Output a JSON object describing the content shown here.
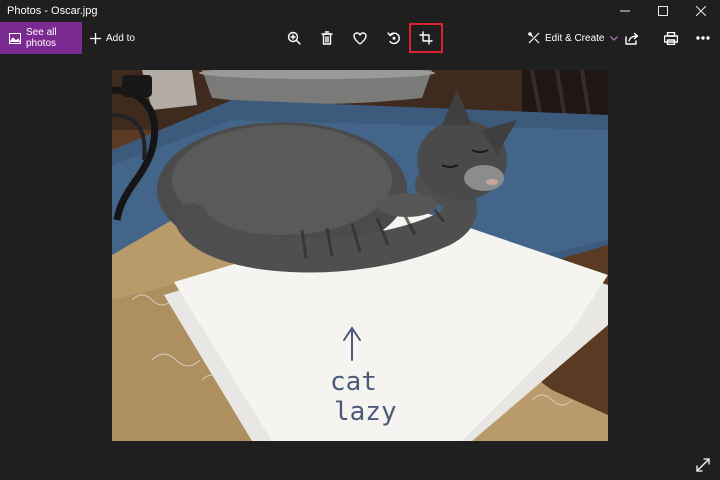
{
  "window": {
    "title": "Photos - Oscar.jpg"
  },
  "toolbar": {
    "see_all_label": "See all photos",
    "add_to_label": "Add to",
    "edit_create_label": "Edit & Create",
    "accent_color": "#7b2a91",
    "highlight_color": "#d9232e"
  },
  "photo": {
    "note_line1": "cat",
    "note_line2": "lazy"
  }
}
